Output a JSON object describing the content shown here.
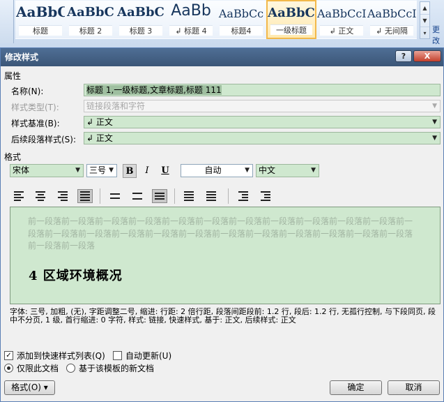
{
  "ribbon": {
    "styles": [
      {
        "sample": "AaBbC",
        "name": "标题"
      },
      {
        "sample": "AaBbC",
        "name": "标题 2"
      },
      {
        "sample": "AaBbC",
        "name": "标题 3"
      },
      {
        "sample": "AaBb",
        "name": "↲ 标题 4"
      },
      {
        "sample": "AaBbCc",
        "name": "标题4"
      },
      {
        "sample": "AaBbC",
        "name": "一级标题"
      },
      {
        "sample": "AaBbCcI",
        "name": "↲ 正文"
      },
      {
        "sample": "AaBbCcI",
        "name": "↲ 无间隔"
      }
    ],
    "more_label": "更改"
  },
  "dialog": {
    "title": "修改样式",
    "help_label": "?",
    "close_label": "X",
    "properties_label": "属性",
    "name_label": "名称(N):",
    "name_value": "标题 1,一级标题,文章标题,标题 111",
    "style_type_label": "样式类型(T):",
    "style_type_value": "链接段落和字符",
    "based_on_label": "样式基准(B):",
    "based_on_value": "↲ 正文",
    "next_style_label": "后续段落样式(S):",
    "next_style_value": "↲ 正文",
    "format_label": "格式",
    "font": "宋体",
    "size": "三号",
    "bold": "B",
    "italic": "I",
    "underline": "U",
    "color": "自动",
    "script": "中文",
    "preview_prev_text": "前一段落前一段落前一段落前一段落前一段落前一段落前一段落前一段落前一段落前一段落前一段落前一段落前一段落前一段落前一段落前一段落前一段落前一段落前一段落前一段落前一段落前一段落前一段落前一段落前一段落",
    "preview_heading": "4 区域环境概况",
    "description": "字体: 三号, 加粗, (无), 字距调整二号, 缩进: 行距: 2 倍行距, 段落间距段前: 1.2 行, 段后: 1.2 行, 无孤行控制, 与下段同页, 段中不分页, 1 级, 首行缩进: 0 字符, 样式: 链接, 快速样式, 基于: 正文, 后续样式: 正文",
    "add_quick_label": "添加到快速样式列表(Q)",
    "auto_update_label": "自动更新(U)",
    "only_doc_label": "仅限此文档",
    "new_docs_label": "基于该模板的新文档",
    "format_button": "格式(O) ▾",
    "ok_button": "确定",
    "cancel_button": "取消"
  }
}
